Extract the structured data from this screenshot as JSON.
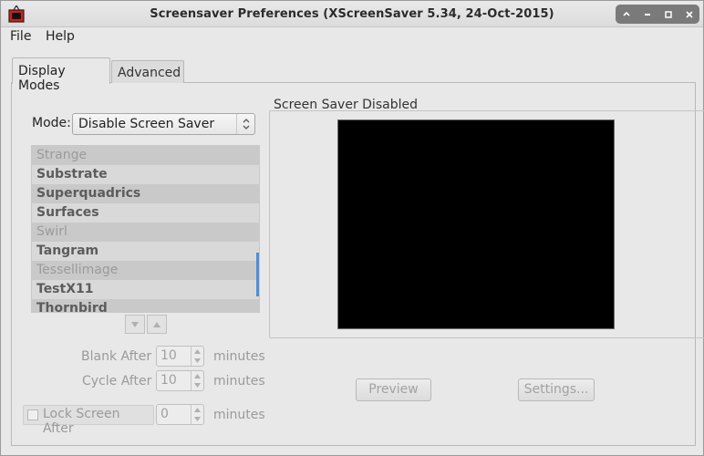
{
  "window": {
    "title": "Screensaver Preferences  (XScreenSaver 5.34, 24-Oct-2015)",
    "controls": [
      "up-icon",
      "minimize-icon",
      "maximize-icon",
      "close-icon"
    ]
  },
  "menubar": {
    "file": "File",
    "help": "Help"
  },
  "tabs": [
    {
      "label": "Display Modes",
      "active": true
    },
    {
      "label": "Advanced",
      "active": false
    }
  ],
  "mode": {
    "label": "Mode:",
    "value": "Disable Screen Saver"
  },
  "hack_list": [
    {
      "name": "Strange",
      "enabled": false
    },
    {
      "name": "Substrate",
      "enabled": true
    },
    {
      "name": "Superquadrics",
      "enabled": true
    },
    {
      "name": "Surfaces",
      "enabled": true
    },
    {
      "name": "Swirl",
      "enabled": false
    },
    {
      "name": "Tangram",
      "enabled": true
    },
    {
      "name": "Tessellimage",
      "enabled": false
    },
    {
      "name": "TestX11",
      "enabled": true
    },
    {
      "name": "Thornbird",
      "enabled": true
    }
  ],
  "timing": {
    "blank_after": {
      "label": "Blank After",
      "value": "10",
      "unit": "minutes"
    },
    "cycle_after": {
      "label": "Cycle After",
      "value": "10",
      "unit": "minutes"
    },
    "lock_after": {
      "label": "Lock Screen After",
      "value": "0",
      "unit": "minutes",
      "checked": false
    }
  },
  "preview": {
    "frame_label": "Screen Saver Disabled",
    "preview_button": "Preview",
    "settings_button": "Settings..."
  },
  "colors": {
    "accent": "#4a90d9",
    "preview_bg": "#000000",
    "app_icon_red": "#d61c1c"
  }
}
